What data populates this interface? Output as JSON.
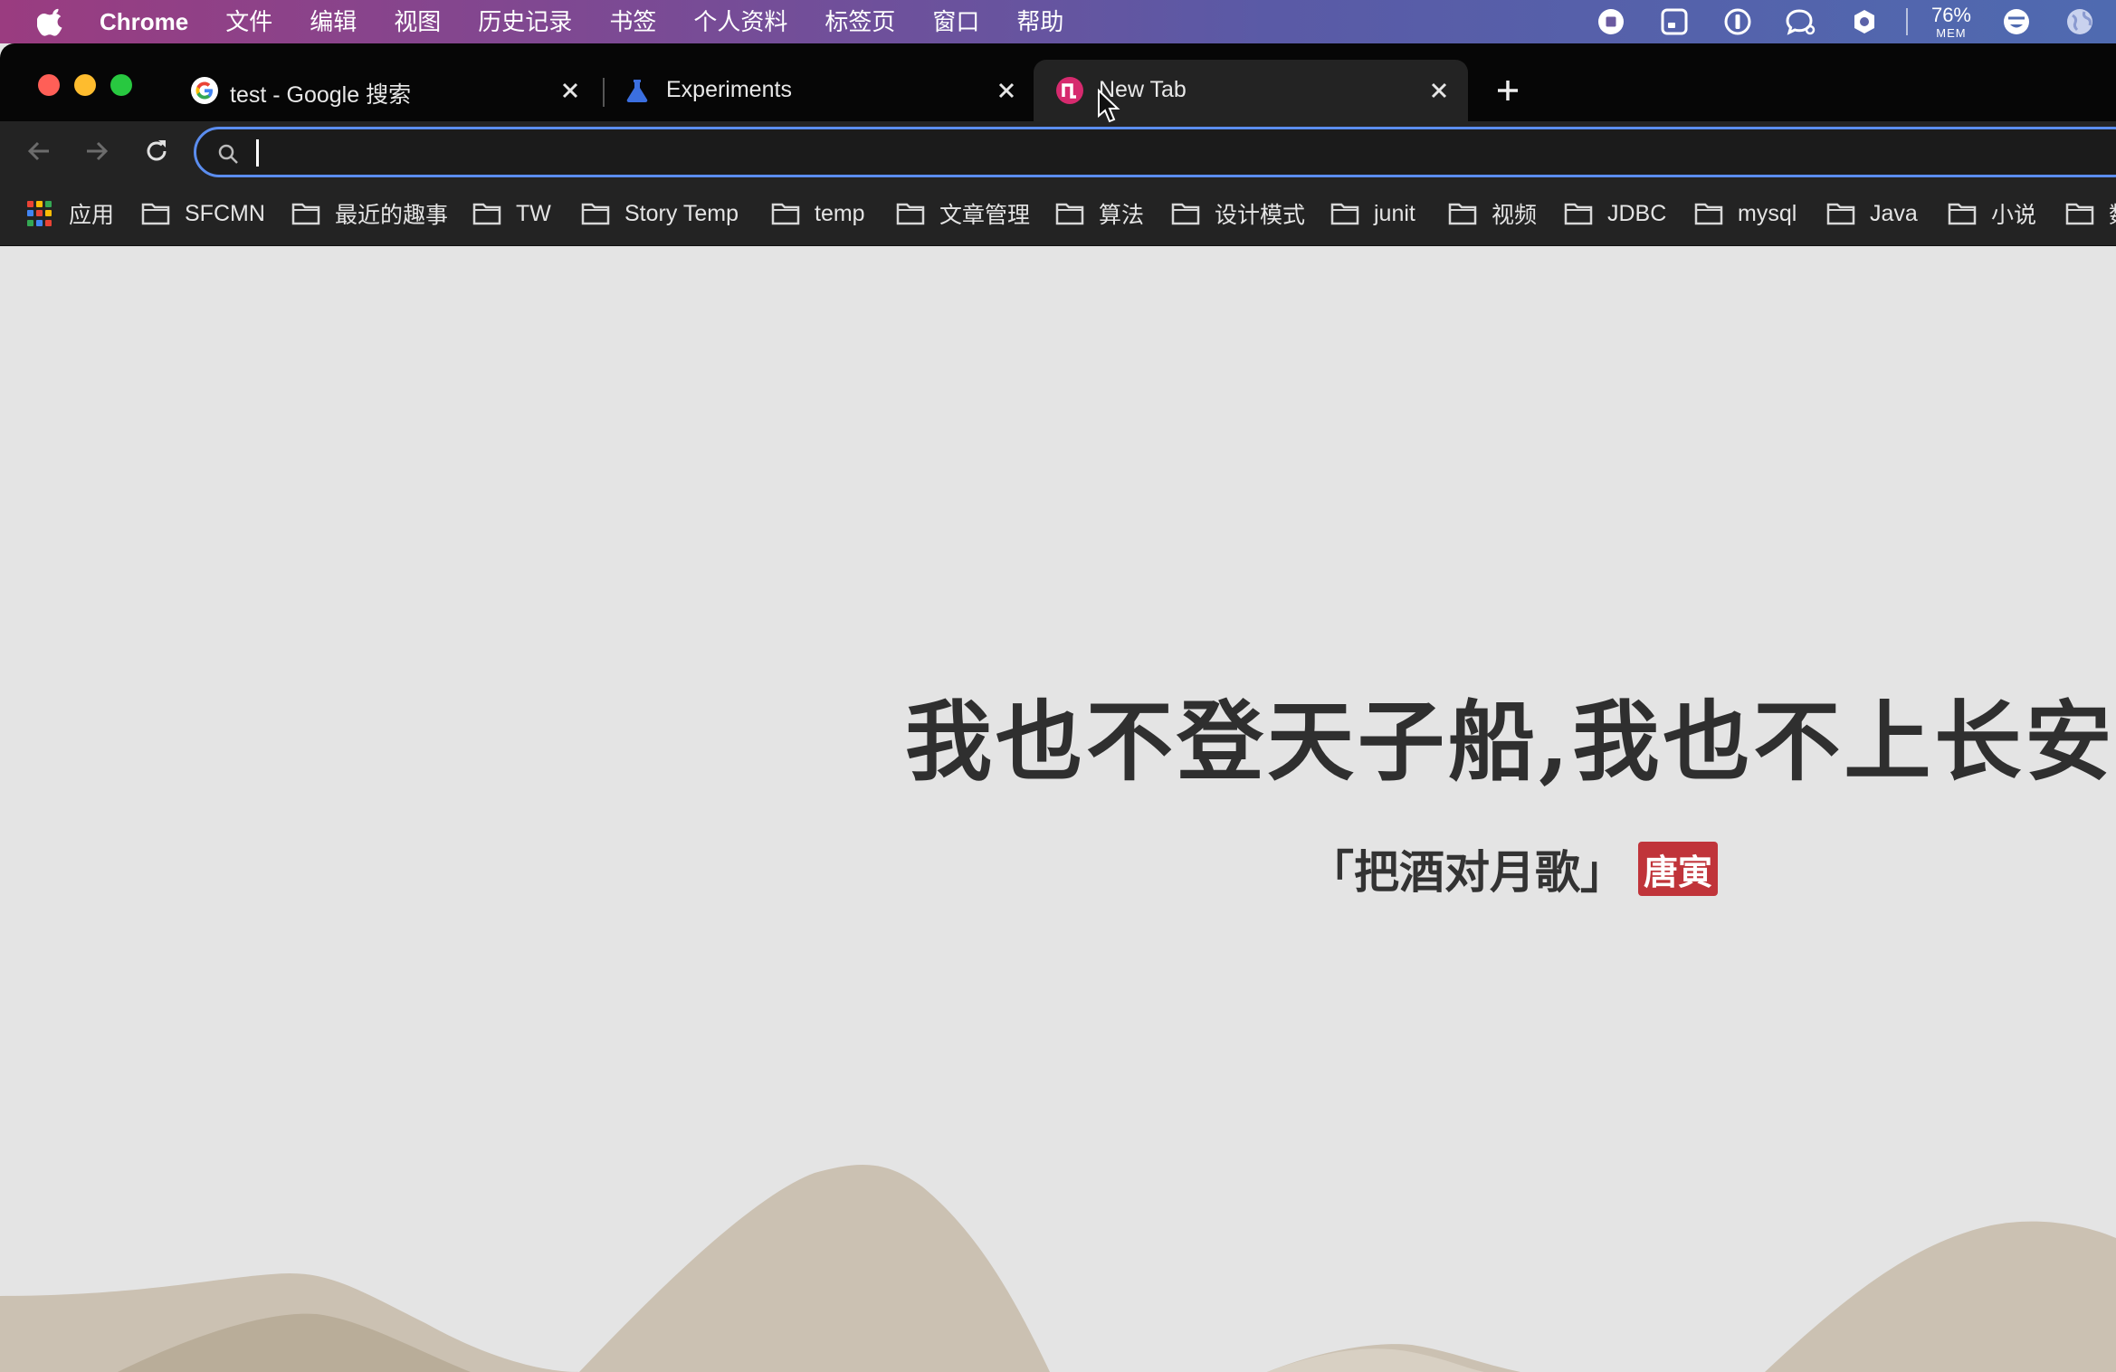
{
  "menubar": {
    "app": "Chrome",
    "items": [
      "文件",
      "编辑",
      "视图",
      "历史记录",
      "书签",
      "个人资料",
      "标签页",
      "窗口",
      "帮助"
    ],
    "memory_percent": "76%",
    "memory_label": "MEM"
  },
  "tabs": [
    {
      "title": "test - Google 搜索",
      "icon": "google-icon",
      "active": false
    },
    {
      "title": "Experiments",
      "icon": "flask-icon",
      "active": false
    },
    {
      "title": "New Tab",
      "icon": "newtab-icon",
      "active": true
    }
  ],
  "omnibox": {
    "value": "",
    "placeholder": ""
  },
  "bookmarks": {
    "apps_label": "应用",
    "folders": [
      "SFCMN",
      "最近的趣事",
      "TW",
      "Story Temp",
      "temp",
      "文章管理",
      "算法",
      "设计模式",
      "junit",
      "视频",
      "JDBC",
      "mysql",
      "Java",
      "小说",
      "数"
    ]
  },
  "page": {
    "poem": "我也不登天子船,我也不上长安眠",
    "source": "「把酒对月歌」",
    "author_seal": "唐寅"
  },
  "colors": {
    "menubar_start": "#9a3c80",
    "menubar_end": "#4f6ab0",
    "omnibox_focus": "#5b8def",
    "seal": "#c0343a",
    "mountain_light": "#cbc1b2",
    "mountain_dark": "#b9ad99"
  }
}
